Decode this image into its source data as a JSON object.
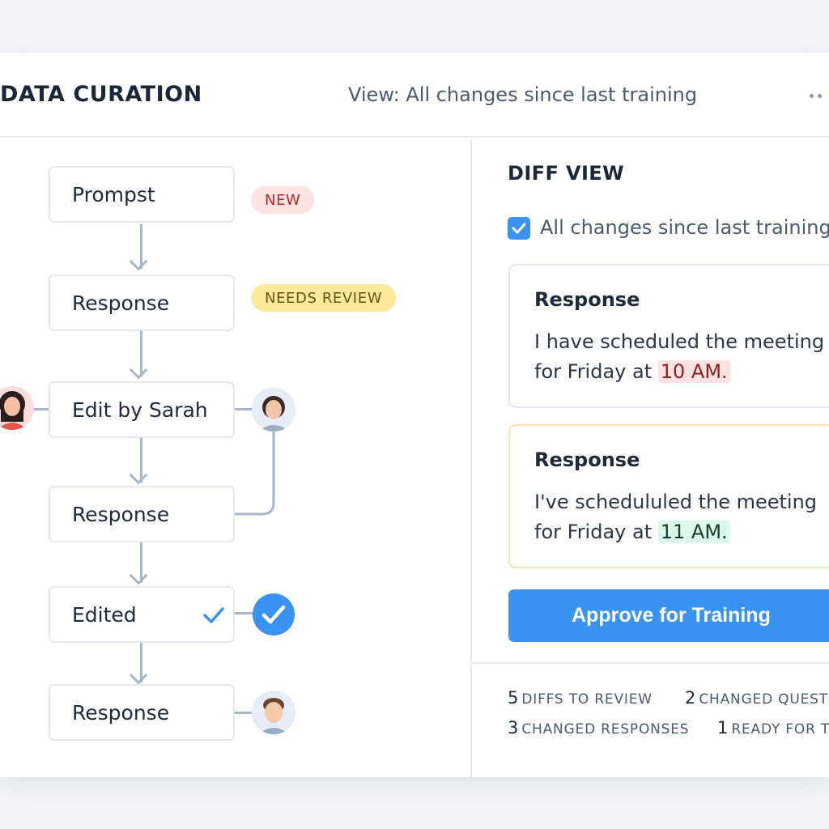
{
  "header": {
    "title": "DATA CURATION",
    "view_label": "View: All changes since last training",
    "more_icon": "more-horizontal-icon"
  },
  "flow": {
    "nodes": [
      {
        "label": "Prompst"
      },
      {
        "label": "Response"
      },
      {
        "label": "Edit by Sarah"
      },
      {
        "label": "Response"
      },
      {
        "label": "Edited"
      },
      {
        "label": "Response"
      }
    ],
    "badges": {
      "new": "NEW",
      "needs_review": "NEEDS REVIEW"
    }
  },
  "diff": {
    "title": "DIFF VIEW",
    "checkbox_label": "All changes since last training",
    "checkbox_checked": true,
    "before": {
      "heading": "Response",
      "line1": "I have scheduled the meeting",
      "line2_prefix": "for Friday at",
      "highlight": "10 AM."
    },
    "after": {
      "heading": "Response",
      "line1": "I've schedululed the meeting",
      "line2_prefix": "for Friday at",
      "highlight": "11 AM."
    },
    "approve_label": "Approve for Training"
  },
  "stats": {
    "diffs_num": "5",
    "diffs_label": "DIFFS TO REVIEW",
    "questions_num": "2",
    "questions_label": "CHANGED QUEST",
    "responses_num": "3",
    "responses_label": "CHANGED RESPONSES",
    "ready_num": "1",
    "ready_label": "READY FOR TI"
  },
  "colors": {
    "accent": "#3a93f2",
    "badge_new_bg": "#fde2e2",
    "badge_review_bg": "#fde99a",
    "removed_bg": "#fde2e2",
    "added_bg": "#ddf7ea"
  }
}
